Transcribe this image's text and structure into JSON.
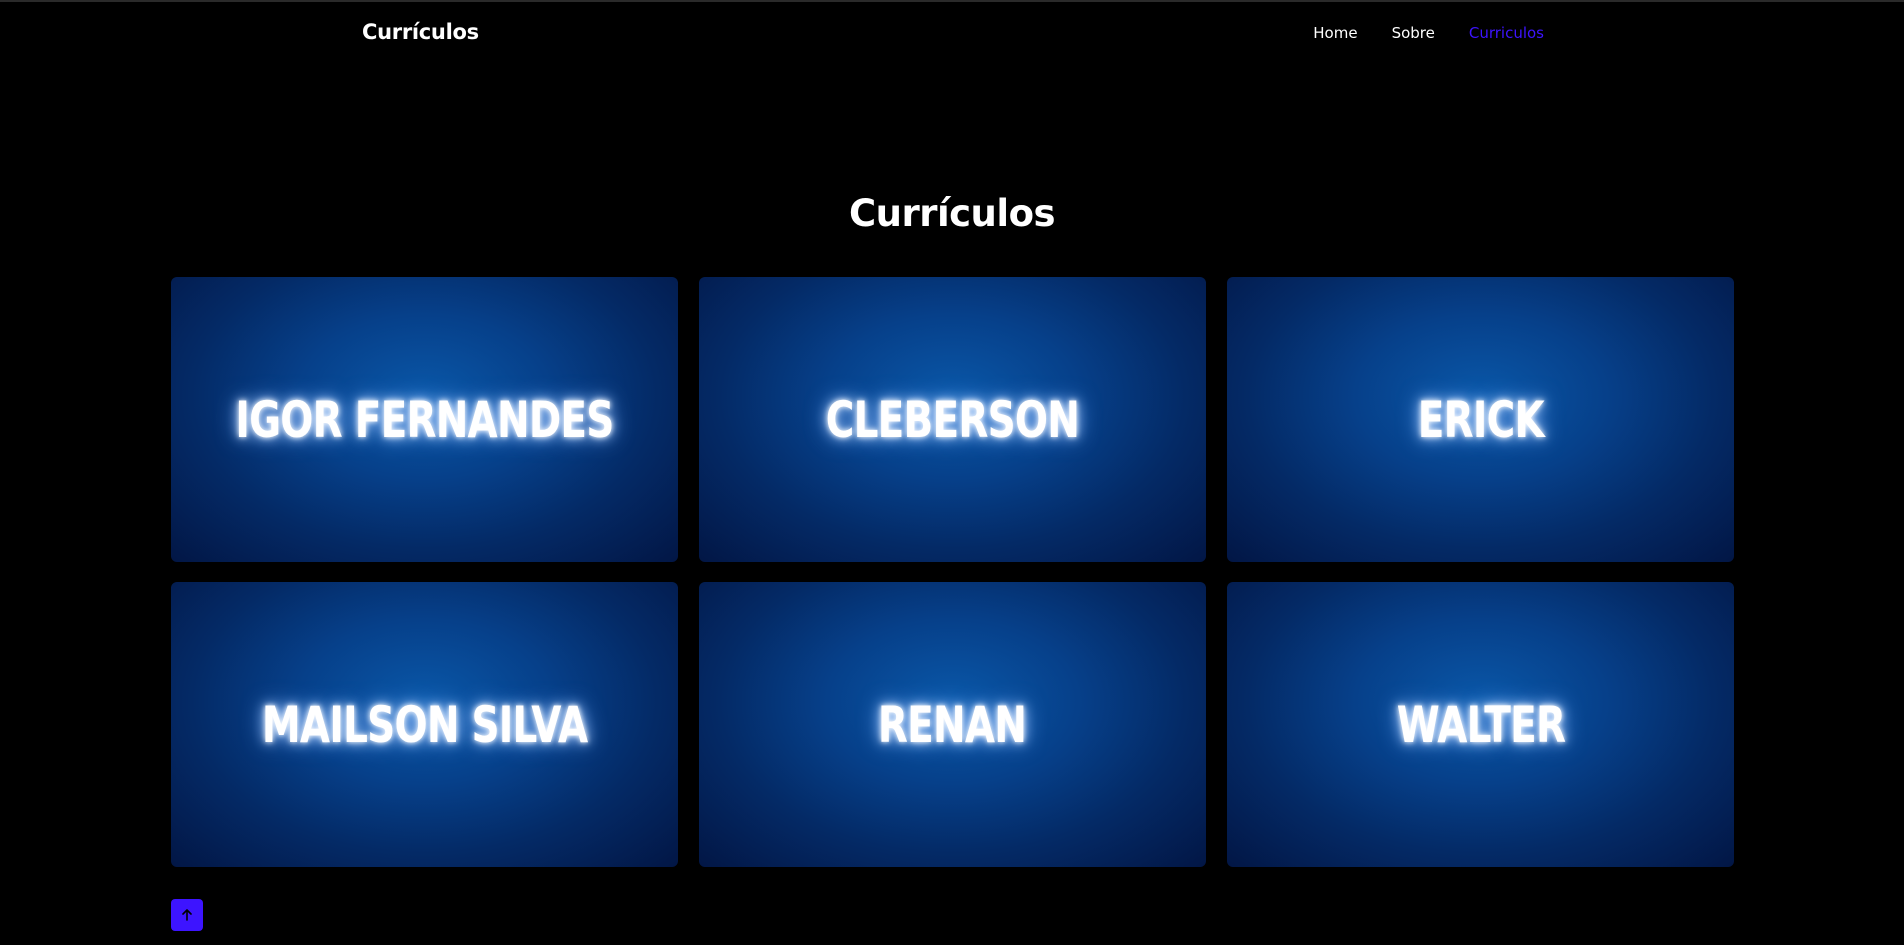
{
  "navbar": {
    "brand": "Currículos",
    "links": [
      {
        "label": "Home"
      },
      {
        "label": "Sobre"
      },
      {
        "label": "Curriculos"
      }
    ]
  },
  "main": {
    "title": "Currículos",
    "cards": [
      {
        "name": "IGOR FERNANDES"
      },
      {
        "name": "CLEBERSON"
      },
      {
        "name": "ERICK"
      },
      {
        "name": "MAILSON SILVA"
      },
      {
        "name": "RENAN"
      },
      {
        "name": "WALTER"
      }
    ]
  },
  "back_to_top": {
    "icon": "arrow-up-icon"
  },
  "colors": {
    "background": "#000000",
    "accent": "#3d14ff",
    "card_blue": "#0a57a8"
  }
}
